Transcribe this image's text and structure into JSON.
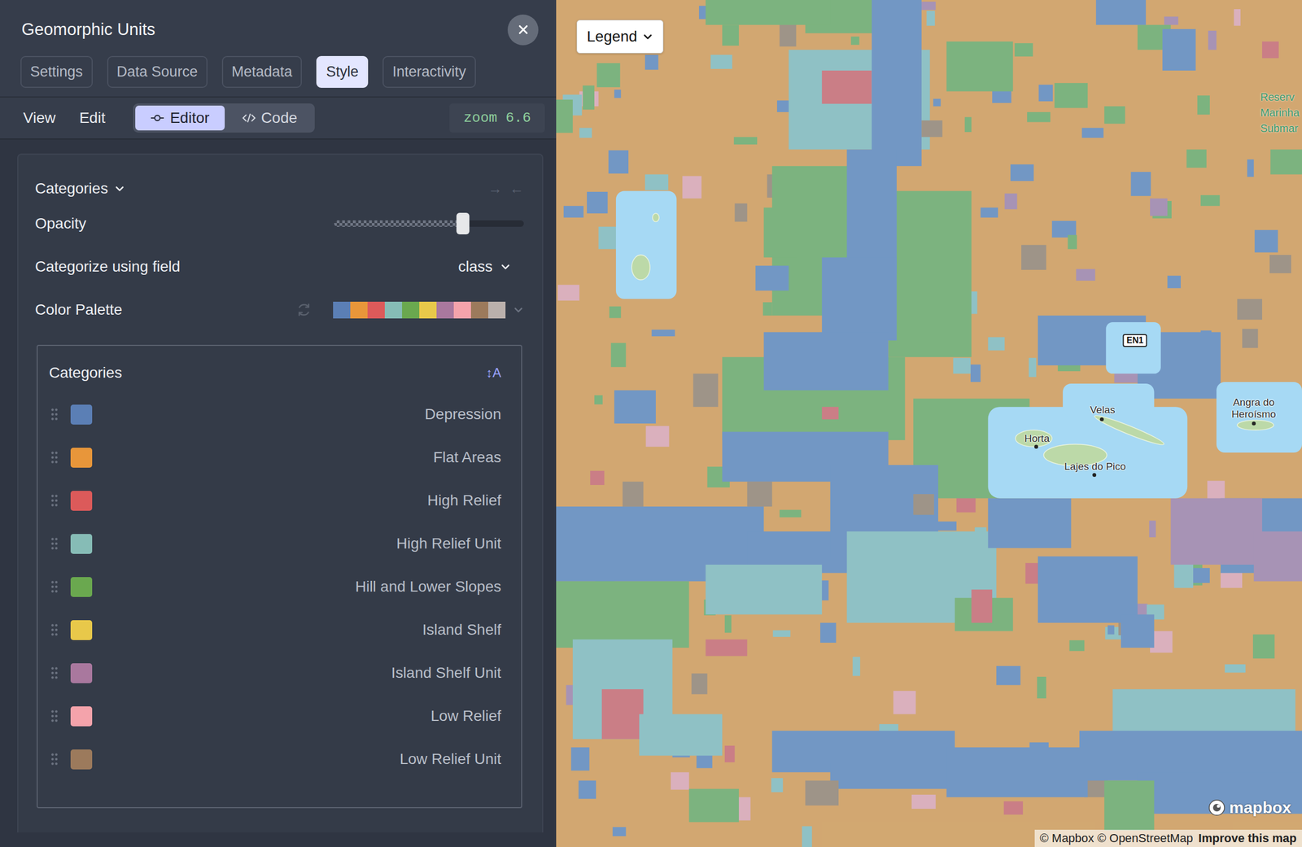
{
  "panel": {
    "title": "Geomorphic Units"
  },
  "tabs": [
    {
      "label": "Settings",
      "selected": false
    },
    {
      "label": "Data Source",
      "selected": false
    },
    {
      "label": "Metadata",
      "selected": false
    },
    {
      "label": "Style",
      "selected": true
    },
    {
      "label": "Interactivity",
      "selected": false
    }
  ],
  "menu": [
    "View",
    "Edit"
  ],
  "modes": [
    {
      "label": "Editor",
      "selected": true
    },
    {
      "label": "Code",
      "selected": false
    }
  ],
  "zoom": "zoom 6.6",
  "style": {
    "type": "Categories",
    "arrows": [
      "→",
      "←"
    ],
    "opacity": {
      "label": "Opacity",
      "level": 0.68
    },
    "field": {
      "label": "Categorize using field",
      "value": "class"
    },
    "palette": {
      "label": "Color Palette",
      "colors": [
        "#5b7fb5",
        "#e8963a",
        "#dc5a5a",
        "#86bcb6",
        "#6aa84f",
        "#e8c84a",
        "#a9789e",
        "#f4a3ab",
        "#9c7a5c",
        "#bab0ac"
      ]
    }
  },
  "categories": {
    "title": "Categories",
    "sort": "↕A",
    "items": [
      {
        "name": "Depression",
        "color": "#5b7fb5"
      },
      {
        "name": "Flat Areas",
        "color": "#e8963a"
      },
      {
        "name": "High Relief",
        "color": "#dc5a5a"
      },
      {
        "name": "High Relief Unit",
        "color": "#86bcb6"
      },
      {
        "name": "Hill and Lower Slopes",
        "color": "#6aa84f"
      },
      {
        "name": "Island Shelf",
        "color": "#e8c84a"
      },
      {
        "name": "Island Shelf Unit",
        "color": "#a9789e"
      },
      {
        "name": "Low Relief",
        "color": "#f4a3ab"
      },
      {
        "name": "Low Relief Unit",
        "color": "#9c7a5c"
      }
    ]
  },
  "map": {
    "legend": "Legend",
    "places": [
      {
        "text": "Velas"
      },
      {
        "text": "Horta"
      },
      {
        "text": "Lajes do Pico"
      },
      {
        "text": "Angra do Heroísmo"
      }
    ],
    "road_shield": "EN1",
    "reserve": [
      "Reserv",
      "Marinha",
      "Submar"
    ],
    "logo": "mapbox",
    "attribution": "© Mapbox © OpenStreetMap",
    "improve": "Improve this map"
  }
}
